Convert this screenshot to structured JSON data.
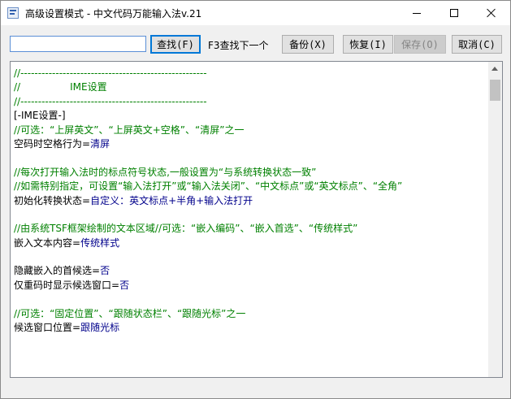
{
  "window": {
    "title": "高级设置模式 - 中文代码万能输入法v.21"
  },
  "toolbar": {
    "search_value": "",
    "find_label": "查找(F)",
    "hint": "F3查找下一个",
    "backup_label": "备份(X)",
    "restore_label": "恢复(I)",
    "save_label": "保存(O)",
    "cancel_label": "取消(C)"
  },
  "editor": {
    "lines": [
      {
        "k": "comment",
        "t": "//-----------------------------------------------------"
      },
      {
        "k": "comment",
        "t": "//                IME设置"
      },
      {
        "k": "comment",
        "t": "//-----------------------------------------------------"
      },
      {
        "k": "section",
        "t": "[-IME设置-]"
      },
      {
        "k": "comment",
        "t": "//可选：“上屏英文”、“上屏英文+空格”、“清屏”之一"
      },
      {
        "k": "kv",
        "key": "空码时空格行为=",
        "val": "清屏"
      },
      {
        "k": "blank",
        "t": ""
      },
      {
        "k": "comment",
        "t": "//每次打开输入法时的标点符号状态,一般设置为“与系统转换状态一致”"
      },
      {
        "k": "comment",
        "t": "//如需特别指定，可设置“输入法打开”或“输入法关闭”、“中文标点”或“英文标点”、“全角”"
      },
      {
        "k": "kv",
        "key": "初始化转换状态=",
        "val": "自定义：英文标点+半角+输入法打开"
      },
      {
        "k": "blank",
        "t": ""
      },
      {
        "k": "comment",
        "t": "//由系统TSF框架绘制的文本区域//可选：“嵌入编码”、“嵌入首选”、“传统样式”"
      },
      {
        "k": "kv",
        "key": "嵌入文本内容=",
        "val": "传统样式"
      },
      {
        "k": "blank",
        "t": ""
      },
      {
        "k": "kv",
        "key": "隐藏嵌入的首候选=",
        "val": "否"
      },
      {
        "k": "kv",
        "key": "仅重码时显示候选窗口=",
        "val": "否"
      },
      {
        "k": "blank",
        "t": ""
      },
      {
        "k": "comment",
        "t": "//可选：“固定位置”、“跟随状态栏”、“跟随光标”之一"
      },
      {
        "k": "kv",
        "key": "候选窗口位置=",
        "val": "跟随光标"
      }
    ]
  }
}
